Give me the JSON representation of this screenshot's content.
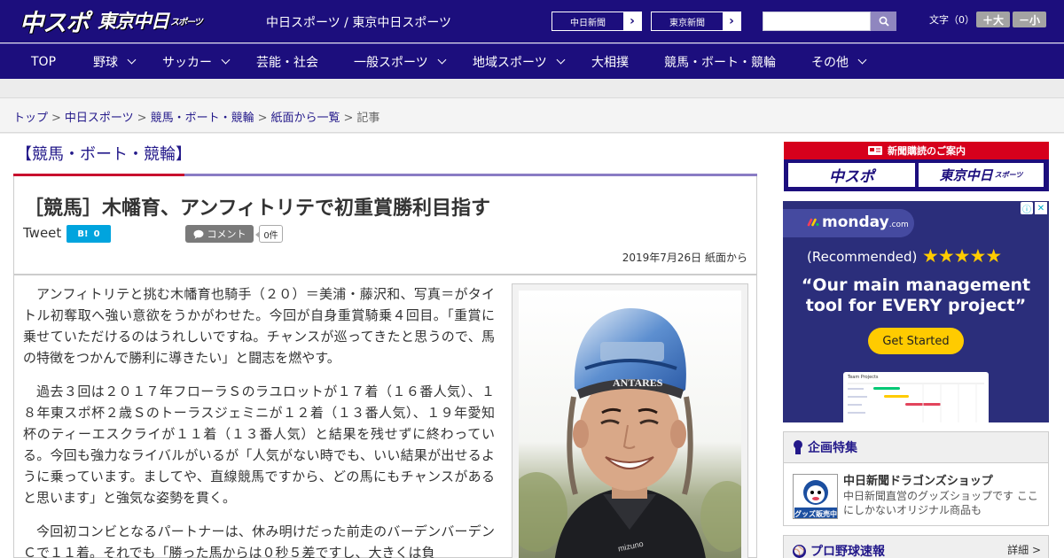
{
  "header": {
    "logo_chuspo": "中スポ",
    "logo_tokyo": "東京中日",
    "logo_tokyo_sub": "スポーツ",
    "site_links": "中日スポーツ / 東京中日スポーツ",
    "paper_links": [
      {
        "label": "中日新聞",
        "arrow": "›"
      },
      {
        "label": "東京新聞",
        "arrow": "›"
      }
    ],
    "search_placeholder": "",
    "font_size_label": "文字（0）",
    "font_larger": "＋大",
    "font_smaller": "－小"
  },
  "nav": [
    {
      "label": "TOP",
      "has_dropdown": false
    },
    {
      "label": "野球",
      "has_dropdown": true
    },
    {
      "label": "サッカー",
      "has_dropdown": true
    },
    {
      "label": "芸能・社会",
      "has_dropdown": false
    },
    {
      "label": "一般スポーツ",
      "has_dropdown": true
    },
    {
      "label": "地域スポーツ",
      "has_dropdown": true
    },
    {
      "label": "大相撲",
      "has_dropdown": false
    },
    {
      "label": "競馬・ボート・競輪",
      "has_dropdown": false
    },
    {
      "label": "その他",
      "has_dropdown": true
    }
  ],
  "breadcrumb": {
    "items": [
      "トップ",
      "中日スポーツ",
      "競馬・ボート・競輪",
      "紙面から一覧"
    ],
    "separator": ">",
    "current": "記事"
  },
  "section": {
    "title": "【競馬・ボート・競輪】"
  },
  "article": {
    "headline": "［競馬］木幡育、アンフィトリテで初重賞勝利目指す",
    "tweet_label": "Tweet",
    "hatena_label": "B!",
    "hatena_count": "0",
    "comment_label": "コメント",
    "comment_count": "0件",
    "dateline": "2019年7月26日 紙面から",
    "paragraphs": [
      "アンフィトリテと挑む木幡育也騎手（２０）＝美浦・藤沢和、写真＝がタイトル初奪取へ強い意欲をうかがわせた。今回が自身重賞騎乗４回目。「重賞に乗せていただけるのはうれしいですね。チャンスが巡ってきたと思うので、馬の特徴をつかんで勝利に導きたい」と闘志を燃やす。",
      "過去３回は２０１７年フローラＳのラユロットが１７着（１６番人気）、１８年東スポ杯２歳Ｓのトーラスジェミニが１２着（１３番人気）、１９年愛知杯のティーエスクライが１１着（１３番人気）と結果を残せずに終わっている。今回も強力なライバルがいるが「人気がない時でも、いい結果が出せるように乗っています。ましてや、直線競馬ですから、どの馬にもチャンスがあると思います」と強気な姿勢を貫く。",
      "今回初コンビとなるパートナーは、休み明けだった前走のバーデンバーデンＣで１１着。それでも「勝った馬からは０秒５差ですし、大きくは負"
    ],
    "photo_helmet_text": "ANTARES",
    "photo_jacket_text": "mizuno"
  },
  "sidebar": {
    "subscribe_banner": {
      "title": "新聞購読のご案内",
      "logo_left": "中スポ",
      "logo_right": "東京中日",
      "logo_right_sub": "スポーツ"
    },
    "ad": {
      "brand": "monday",
      "brand_suffix": ".com",
      "info_icon": "ⓘ",
      "close_icon": "✕",
      "recommended": "(Recommended)",
      "stars": "★★★★★",
      "quote": "“Our main management tool for EVERY project”",
      "cta": "Get Started",
      "screenshot_title": "Team Projects"
    },
    "featured": {
      "heading": "企画特集",
      "item_title": "中日新聞ドラゴンズショップ",
      "item_desc": "中日新聞直営のグッズショップです ここにしかないオリジナル商品も",
      "thumb_label": "グッズ販売中"
    },
    "baseball": {
      "heading": "プロ野球速報",
      "link": "詳細 >"
    }
  },
  "colors": {
    "brand_navy": "#1c0e7d",
    "link_blue": "#23198a",
    "accent_red": "#c8102e",
    "hatena_blue": "#00a4de",
    "ad_bg": "#2b2e7b",
    "ad_yellow": "#ffcb00"
  },
  "icons": {
    "search": "search-icon",
    "comment": "speech-bubble-icon",
    "featured": "ribbon-icon",
    "baseball": "baseball-icon",
    "newspaper": "newspaper-icon"
  }
}
